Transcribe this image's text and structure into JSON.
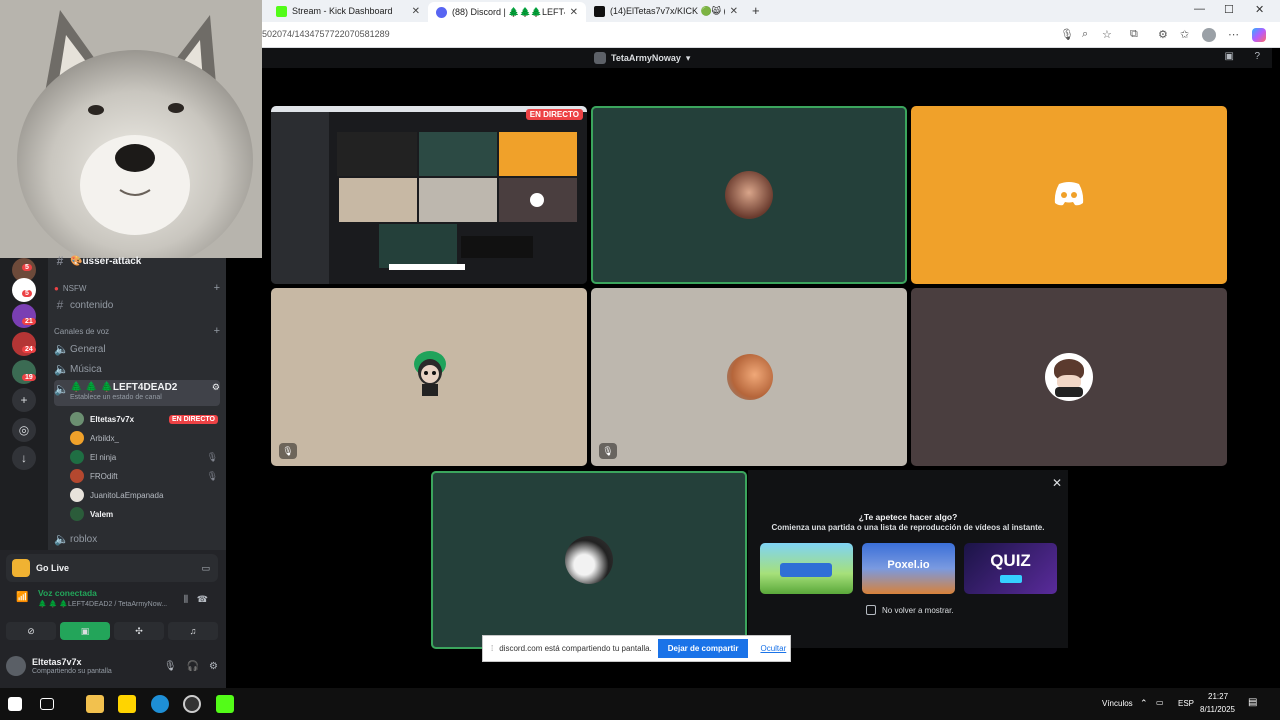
{
  "browser": {
    "tabs": [
      {
        "label": "Stream - Kick Dashboard",
        "color": "#53fc18"
      },
      {
        "label": "(88) Discord | 🌲🌲🌲LEFT4",
        "color": "#5865f2"
      },
      {
        "label": "(14)ElTetas7v7x/KICK 🟢😸 (@elt",
        "color": "#111111"
      }
    ],
    "new_tab": "+",
    "url": "502074/1434757722070581289"
  },
  "discord": {
    "top_title": "TetaArmyNoway",
    "tile_live_badge": "EN DIRECTO",
    "sidebar": {
      "channels": {
        "usser_attack": "🎨usser-attack",
        "nsfw_category": "NSFW",
        "contenido": "contenido",
        "voice_category": "Canales de voz",
        "general": "General",
        "musica": "Música",
        "left4dead2": "🌲 🌲 🌲LEFT4DEAD2",
        "channel_status": "Establece un estado de canal",
        "roblox": "roblox"
      },
      "voice_users": [
        {
          "name": "Eltetas7v7x",
          "badge": "EN DIRECTO",
          "color": "#6b8f71"
        },
        {
          "name": "Arbildx_",
          "badge": "",
          "color": "#f0a12a"
        },
        {
          "name": "El ninja",
          "badge": "",
          "color": "#1f6e43"
        },
        {
          "name": "FROdift",
          "badge": "",
          "color": "#b4482f"
        },
        {
          "name": "JuanitoLaEmpanada",
          "badge": "",
          "color": "#e8e3dc"
        },
        {
          "name": "Valem",
          "badge": "",
          "color": "#2b5c3a"
        }
      ],
      "guild_badges": [
        "5",
        "5",
        "21",
        "24",
        "19"
      ]
    },
    "panel": {
      "go_live": "Go Live",
      "voice_title": "Voz conectada",
      "voice_sub": "🌲 🌲 🌲LEFT4DEAD2 / TetaArmyNow...",
      "user_name": "Eltetas7v7x",
      "user_status": "Compartiendo su pantalla"
    },
    "activity": {
      "title": "¿Te apetece hacer algo?",
      "subtitle": "Comienza una partida o una lista de reproducción de vídeos al instante.",
      "games": [
        "",
        "Poxel.io",
        "QUIZ"
      ],
      "checkbox_label": "No volver a mostrar."
    },
    "sharebar": {
      "text": "discord.com está compartiendo tu pantalla.",
      "stop": "Dejar de compartir",
      "hide": "Ocultar"
    }
  },
  "taskbar": {
    "links": "Vínculos",
    "lang": "ESP",
    "time": "21:27",
    "date": "8/11/2025"
  }
}
